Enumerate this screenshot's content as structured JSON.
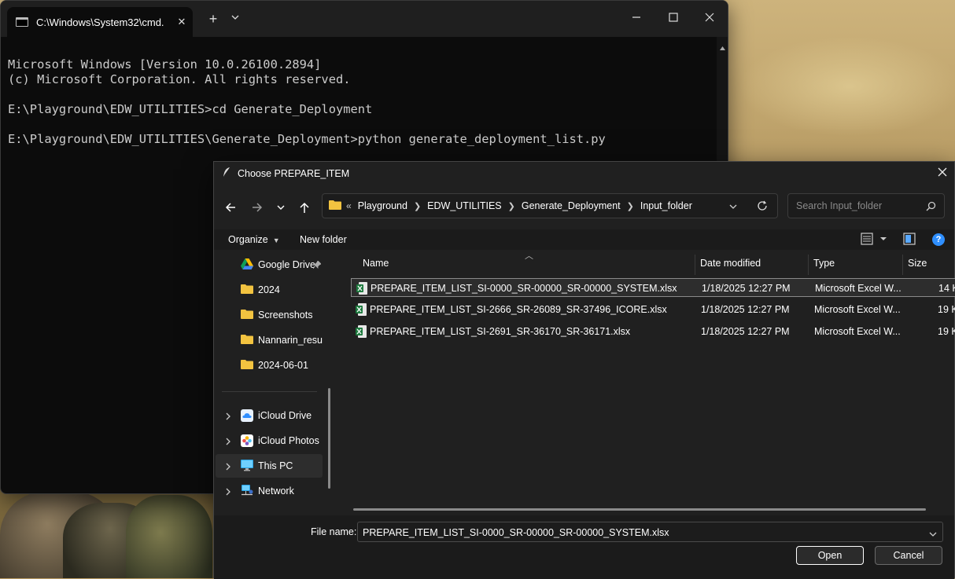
{
  "terminal": {
    "tab_title": "C:\\Windows\\System32\\cmd.",
    "lines": [
      "Microsoft Windows [Version 10.0.26100.2894]",
      "(c) Microsoft Corporation. All rights reserved.",
      "",
      "E:\\Playground\\EDW_UTILITIES>cd Generate_Deployment",
      "",
      "E:\\Playground\\EDW_UTILITIES\\Generate_Deployment>python generate_deployment_list.py"
    ]
  },
  "dialog": {
    "title": "Choose PREPARE_ITEM",
    "breadcrumb": {
      "overflow": "«",
      "items": [
        "Playground",
        "EDW_UTILITIES",
        "Generate_Deployment",
        "Input_folder"
      ]
    },
    "search": {
      "placeholder": "Search Input_folder"
    },
    "commands": {
      "organize": "Organize",
      "new_folder": "New folder"
    },
    "nav": {
      "quick": [
        {
          "label": "Google Drive",
          "icon": "google-drive-icon",
          "pinned": true
        },
        {
          "label": "2024",
          "icon": "folder-icon"
        },
        {
          "label": "Screenshots",
          "icon": "folder-icon"
        },
        {
          "label": "Nannarin_resum",
          "icon": "folder-icon"
        },
        {
          "label": "2024-06-01",
          "icon": "folder-icon"
        }
      ],
      "locations": [
        {
          "label": "iCloud Drive",
          "icon": "icloud-drive-icon"
        },
        {
          "label": "iCloud Photos",
          "icon": "icloud-photos-icon"
        },
        {
          "label": "This PC",
          "icon": "this-pc-icon",
          "selected": true
        },
        {
          "label": "Network",
          "icon": "network-icon"
        }
      ]
    },
    "columns": {
      "name": "Name",
      "date": "Date modified",
      "type": "Type",
      "size": "Size"
    },
    "files": [
      {
        "name": "PREPARE_ITEM_LIST_SI-0000_SR-00000_SR-00000_SYSTEM.xlsx",
        "date": "1/18/2025 12:27 PM",
        "type": "Microsoft Excel W...",
        "size": "14 K",
        "selected": true
      },
      {
        "name": "PREPARE_ITEM_LIST_SI-2666_SR-26089_SR-37496_ICORE.xlsx",
        "date": "1/18/2025 12:27 PM",
        "type": "Microsoft Excel W...",
        "size": "19 K"
      },
      {
        "name": "PREPARE_ITEM_LIST_SI-2691_SR-36170_SR-36171.xlsx",
        "date": "1/18/2025 12:27 PM",
        "type": "Microsoft Excel W...",
        "size": "19 K"
      }
    ],
    "filename_label": "File name:",
    "filename_value": "PREPARE_ITEM_LIST_SI-0000_SR-00000_SR-00000_SYSTEM.xlsx",
    "buttons": {
      "open": "Open",
      "cancel": "Cancel"
    }
  },
  "colors": {
    "accent": "#2f8fff",
    "excel_green": "#1d7a3e",
    "folder_yellow": "#f2c340"
  }
}
